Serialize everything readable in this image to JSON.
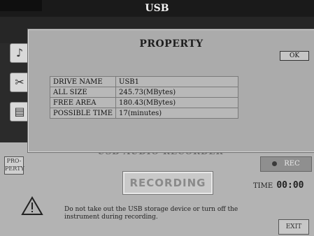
{
  "header": {
    "title": "USB"
  },
  "dialog": {
    "title": "PROPERTY",
    "ok_label": "OK",
    "rows": [
      {
        "label": "DRIVE NAME",
        "value": "USB1"
      },
      {
        "label": "ALL SIZE",
        "value": "245.73(MBytes)"
      },
      {
        "label": "FREE AREA",
        "value": "180.43(MBytes)"
      },
      {
        "label": "POSSIBLE TIME",
        "value": "17(minutes)"
      }
    ]
  },
  "recorder": {
    "title": "USB AUDIO RECORDER",
    "property_button": "PRO-\nPERTY",
    "recording_label": "RECORDING",
    "rec_label": "REC",
    "time_label": "TIME",
    "time_value": "00:00",
    "warning": "Do not take out the USB storage device or turn off the instrument during recording.",
    "exit_label": "EXIT"
  },
  "side_icons": [
    {
      "name": "music-note-icon",
      "glyph": "♪"
    },
    {
      "name": "scissors-icon",
      "glyph": "✂"
    },
    {
      "name": "document-icon",
      "glyph": "▤"
    }
  ]
}
